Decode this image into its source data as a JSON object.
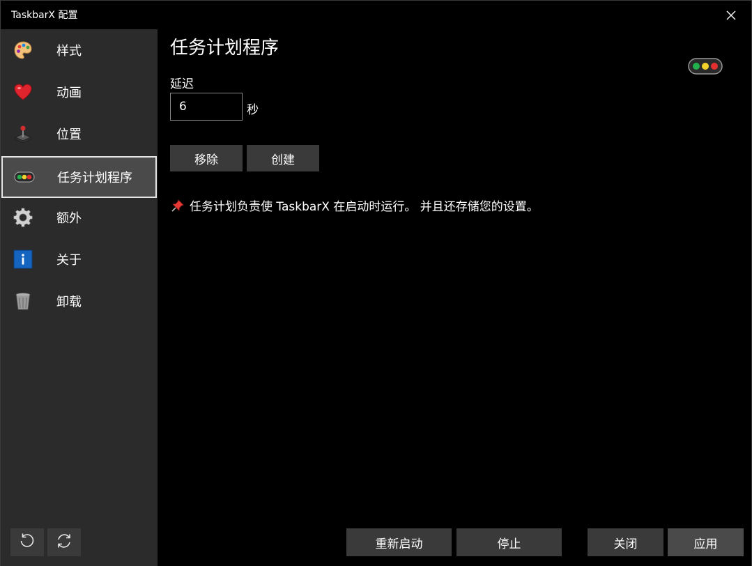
{
  "window": {
    "title": "TaskbarX 配置"
  },
  "sidebar": {
    "items": [
      {
        "label": "样式",
        "icon": "palette-icon"
      },
      {
        "label": "动画",
        "icon": "heart-icon"
      },
      {
        "label": "位置",
        "icon": "joystick-icon"
      },
      {
        "label": "任务计划程序",
        "icon": "traffic-light-icon",
        "active": true
      },
      {
        "label": "额外",
        "icon": "gear-icon"
      },
      {
        "label": "关于",
        "icon": "info-icon"
      },
      {
        "label": "卸载",
        "icon": "trash-icon"
      }
    ],
    "bottom_buttons": [
      "undo-icon",
      "refresh-icon"
    ]
  },
  "main": {
    "title": "任务计划程序",
    "delay_label": "延迟",
    "delay_value": "6",
    "delay_unit": "秒",
    "remove_label": "移除",
    "create_label": "创建",
    "info_text": "任务计划负责使 TaskbarX 在启动时运行。 并且还存储您的设置。"
  },
  "footer": {
    "restart_label": "重新启动",
    "stop_label": "停止",
    "close_label": "关闭",
    "apply_label": "应用"
  },
  "colors": {
    "sidebar_bg": "#2b2b2b",
    "active_bg": "#4a4a4a",
    "button_bg": "#3a3a3a",
    "main_bg": "#000000"
  }
}
